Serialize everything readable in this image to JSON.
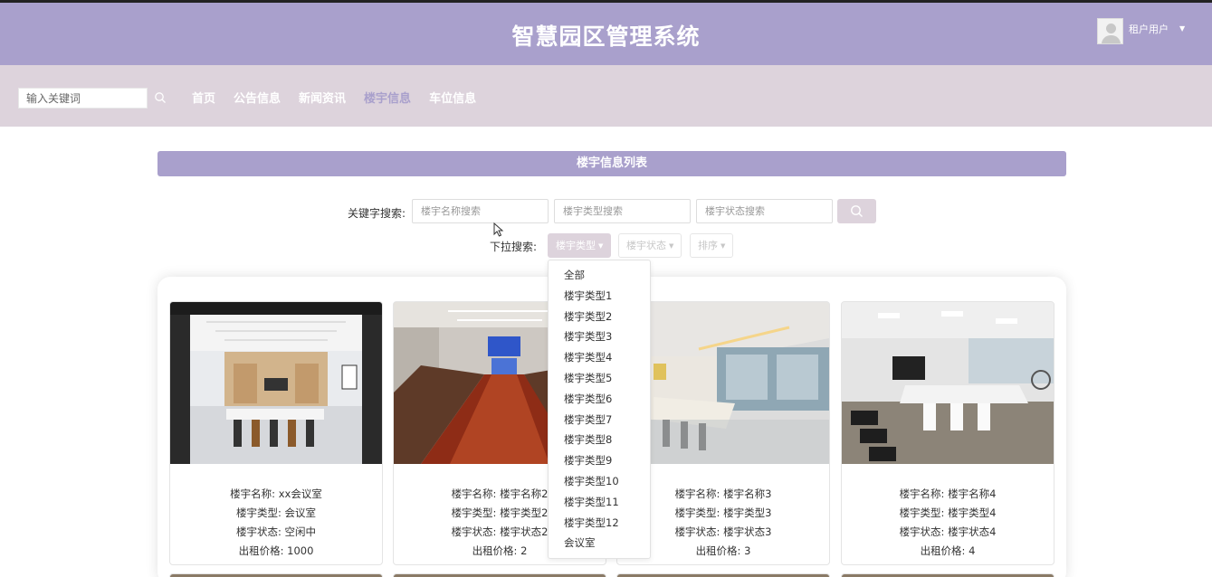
{
  "header": {
    "title": "智慧园区管理系统",
    "username": "租户用户"
  },
  "nav": {
    "search_placeholder": "输入关键词",
    "links": [
      "首页",
      "公告信息",
      "新闻资讯",
      "楼宇信息",
      "车位信息"
    ],
    "active": "楼宇信息"
  },
  "panel": {
    "title": "楼宇信息列表"
  },
  "search": {
    "keyword_label": "关键字搜索:",
    "name_placeholder": "楼宇名称搜索",
    "type_placeholder": "楼宇类型搜索",
    "status_placeholder": "楼宇状态搜索"
  },
  "dropdowns": {
    "label": "下拉搜索:",
    "type": "楼宇类型",
    "status": "楼宇状态",
    "sort": "排序"
  },
  "type_menu": [
    "全部",
    "楼宇类型1",
    "楼宇类型2",
    "楼宇类型3",
    "楼宇类型4",
    "楼宇类型5",
    "楼宇类型6",
    "楼宇类型7",
    "楼宇类型8",
    "楼宇类型9",
    "楼宇类型10",
    "楼宇类型11",
    "楼宇类型12",
    "会议室"
  ],
  "cards": [
    {
      "name": "楼宇名称: xx会议室",
      "type": "楼宇类型: 会议室",
      "status": "楼宇状态: 空闲中",
      "price": "出租价格: 1000"
    },
    {
      "name": "楼宇名称: 楼宇名称2",
      "type": "楼宇类型: 楼宇类型2",
      "status": "楼宇状态: 楼宇状态2",
      "price": "出租价格: 2"
    },
    {
      "name": "楼宇名称: 楼宇名称3",
      "type": "楼宇类型: 楼宇类型3",
      "status": "楼宇状态: 楼宇状态3",
      "price": "出租价格: 3"
    },
    {
      "name": "楼宇名称: 楼宇名称4",
      "type": "楼宇类型: 楼宇类型4",
      "status": "楼宇状态: 楼宇状态4",
      "price": "出租价格: 4"
    }
  ],
  "colors": {
    "header": "#a9a0cc",
    "navbar": "#ddd3dc",
    "accent": "#a9a0cc"
  }
}
